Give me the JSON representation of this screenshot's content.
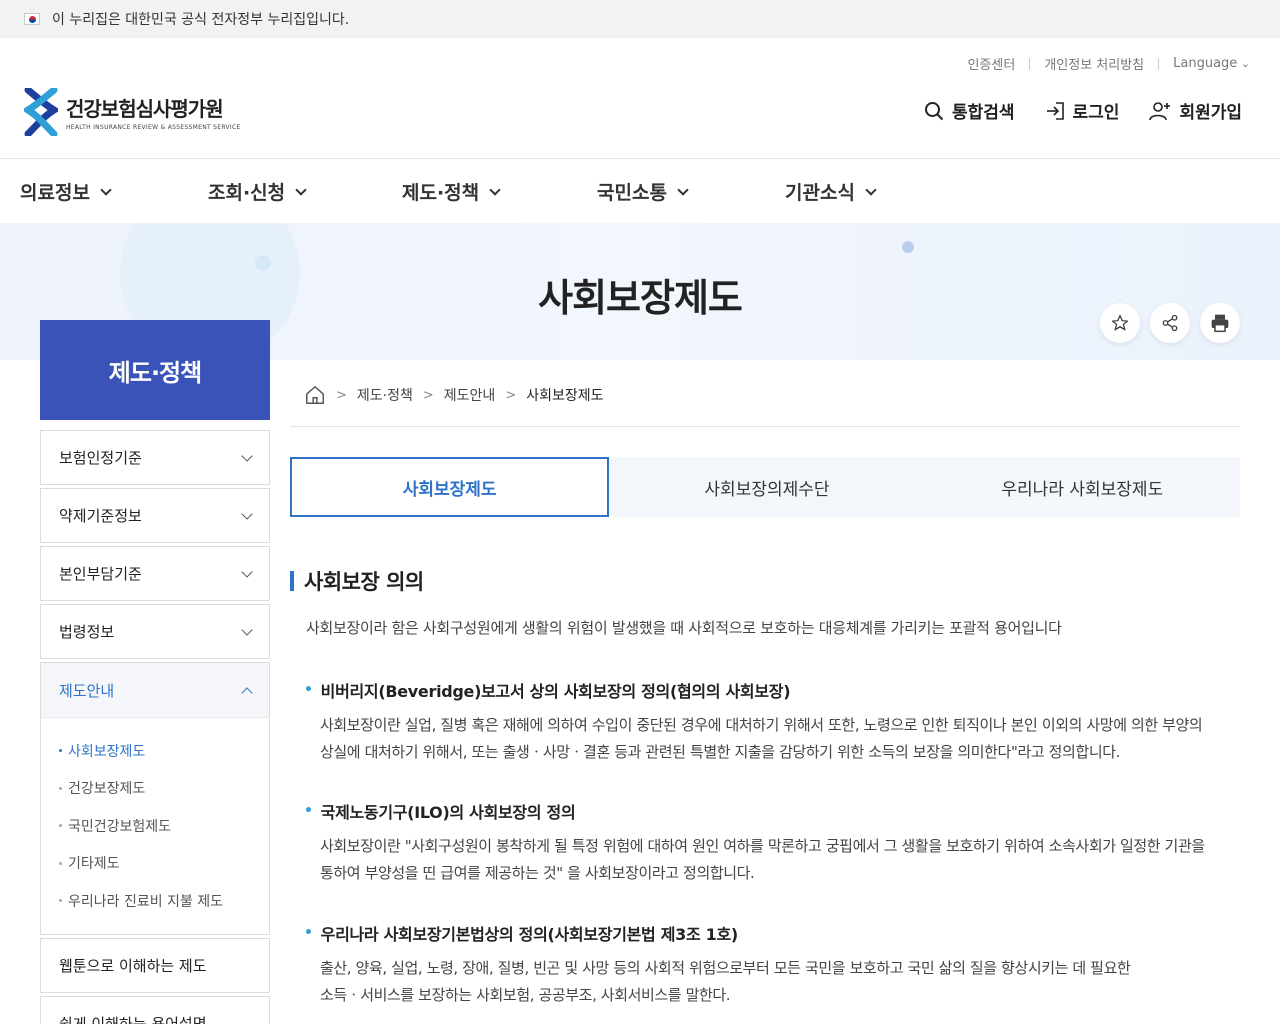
{
  "gov_banner": {
    "text": "이 누리집은 대한민국 공식 전자정부 누리집입니다."
  },
  "header": {
    "util": [
      "인증센터",
      "개인정보 처리방침",
      "Language"
    ],
    "logo_ko": "건강보험심사평가원",
    "logo_en": "HEALTH INSURANCE REVIEW & ASSESSMENT SERVICE",
    "actions": {
      "search": "통합검색",
      "login": "로그인",
      "join": "회원가입"
    }
  },
  "gnb": [
    "의료정보",
    "조회·신청",
    "제도·정책",
    "국민소통",
    "기관소식"
  ],
  "hero": {
    "title": "사회보장제도"
  },
  "lnb": {
    "title": "제도·정책",
    "items": [
      "보험인정기준",
      "약제기준정보",
      "본인부담기준",
      "법령정보",
      "제도안내"
    ],
    "sub": [
      "사회보장제도",
      "건강보장제도",
      "국민건강보험제도",
      "기타제도",
      "우리나라 진료비 지불 제도"
    ],
    "extra": [
      "웹툰으로 이해하는 제도",
      "쉽게 이해하는 용어설명"
    ]
  },
  "breadcrumb": [
    "제도·정책",
    "제도안내",
    "사회보장제도"
  ],
  "tabs": [
    "사회보장제도",
    "사회보장의제수단",
    "우리나라 사회보장제도"
  ],
  "content": {
    "title": "사회보장 의의",
    "intro": "사회보장이라 함은 사회구성원에게 생활의 위험이 발생했을 때 사회적으로 보호하는 대응체계를 가리키는 포괄적 용어입니다",
    "items": [
      {
        "heading": "비버리지(Beveridge)보고서 상의 사회보장의 정의(협의의 사회보장)",
        "line1": "사회보장이란 실업, 질병 혹은 재해에 의하여 수입이 중단된 경우에 대처하기 위해서 또한, 노령으로 인한 퇴직이나 본인 이외의 사망에 의한 부양의",
        "line2": "상실에 대처하기 위해서, 또는 출생ㆍ사망ㆍ결혼 등과 관련된 특별한 지출을 감당하기 위한 소득의 보장을 의미한다\"라고 정의합니다."
      },
      {
        "heading": "국제노동기구(ILO)의 사회보장의 정의",
        "line1": "사회보장이란 \"사회구성원이 봉착하게 될 특정 위험에 대하여 원인 여하를 막론하고 궁핍에서 그 생활을 보호하기 위하여 소속사회가 일정한 기관을",
        "line2": "통하여 부양성을 띤 급여를 제공하는 것\" 을 사회보장이라고 정의합니다."
      },
      {
        "heading": "우리나라 사회보장기본법상의 정의(사회보장기본법 제3조 1호)",
        "line1": "출산, 양육, 실업, 노령, 장애, 질병, 빈곤 및 사망 등의 사회적 위험으로부터 모든 국민을 보호하고 국민 삶의 질을 향상시키는 데 필요한",
        "line2": "소득ㆍ서비스를 보장하는 사회보험, 공공부조, 사회서비스를 말한다."
      }
    ]
  },
  "colors": {
    "primary": "#3a53b8",
    "accent": "#2f73c8"
  }
}
